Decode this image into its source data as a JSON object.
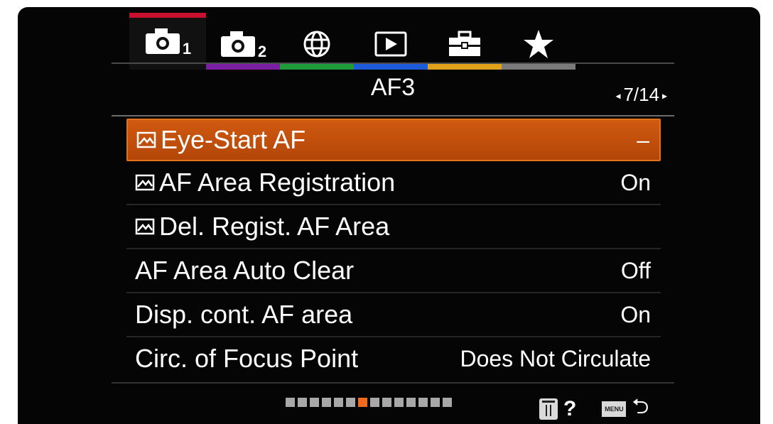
{
  "tabs": [
    {
      "name": "camera1",
      "num": "1",
      "color": "#c8102e",
      "active": true
    },
    {
      "name": "camera2",
      "num": "2",
      "color": "#7a1fa2"
    },
    {
      "name": "network",
      "color": "#1f9b3a"
    },
    {
      "name": "playback",
      "color": "#1d5bd8"
    },
    {
      "name": "setup",
      "color": "#e0a21a"
    },
    {
      "name": "my-menu",
      "color": "#7a7a7a"
    }
  ],
  "header": {
    "title": "AF3",
    "page": "7/14"
  },
  "items": [
    {
      "label": "Eye-Start AF",
      "value": "–",
      "icon": true,
      "selected": true
    },
    {
      "label": "AF Area Registration",
      "value": "On",
      "icon": true
    },
    {
      "label": "Del. Regist. AF Area",
      "value": "",
      "icon": true
    },
    {
      "label": "AF Area Auto Clear",
      "value": "Off",
      "icon": false
    },
    {
      "label": "Disp. cont. AF area",
      "value": "On",
      "icon": false
    },
    {
      "label": "Circ. of Focus Point",
      "value": "Does Not Circulate",
      "icon": false
    }
  ],
  "pager": {
    "total": 14,
    "current": 7
  },
  "footer": {
    "help": "?",
    "menu_label": "MENU"
  }
}
